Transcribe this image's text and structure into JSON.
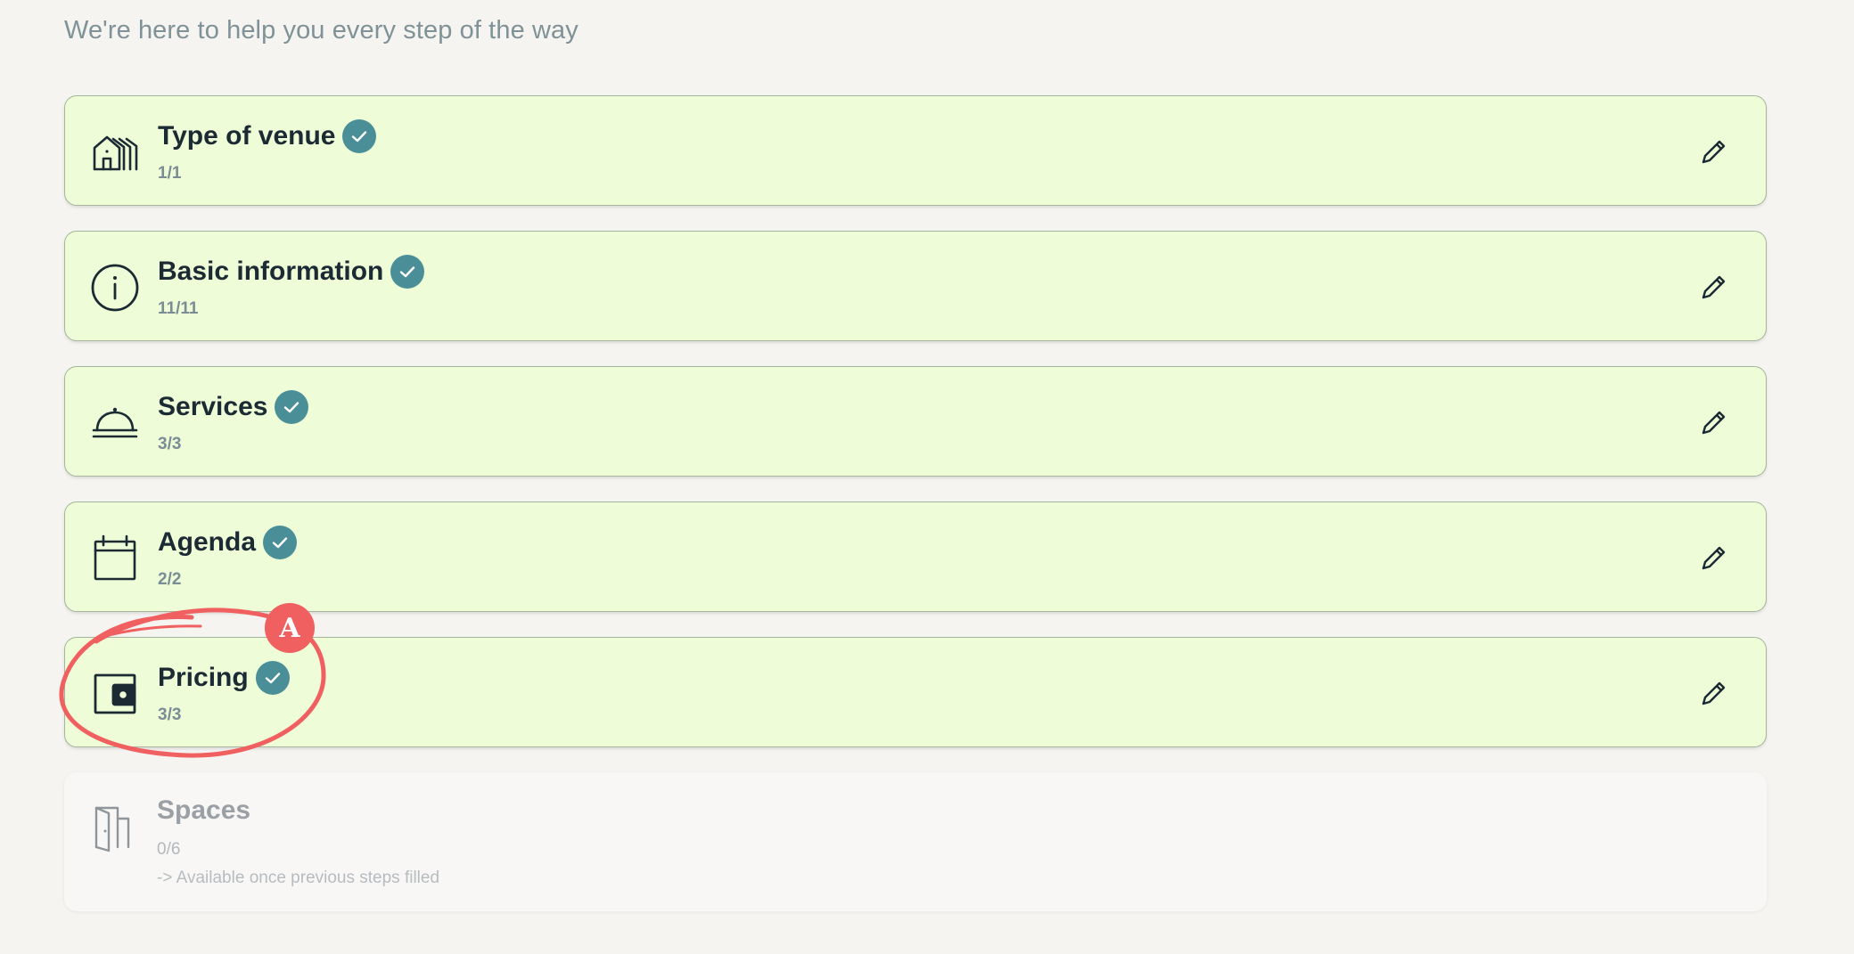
{
  "header": {
    "subtitle": "We're here to help you every step of the way"
  },
  "steps": [
    {
      "title": "Type of venue",
      "count": "1/1",
      "status": "complete",
      "icon": "houses-icon"
    },
    {
      "title": "Basic information",
      "count": "11/11",
      "status": "complete",
      "icon": "info-icon"
    },
    {
      "title": "Services",
      "count": "3/3",
      "status": "complete",
      "icon": "cloche-icon"
    },
    {
      "title": "Agenda",
      "count": "2/2",
      "status": "complete",
      "icon": "calendar-icon"
    },
    {
      "title": "Pricing",
      "count": "3/3",
      "status": "complete",
      "icon": "wallet-icon"
    },
    {
      "title": "Spaces",
      "count": "0/6",
      "note": "-> Available once previous steps filled",
      "status": "locked",
      "icon": "door-icon"
    }
  ],
  "annotation": {
    "marker_label": "A",
    "color": "#f06060",
    "target": "Pricing"
  },
  "colors": {
    "page_background": "#f5f4f1",
    "complete_card": "#eefdd8",
    "check_badge": "#4a8f98",
    "title_text": "#1b2a33"
  }
}
